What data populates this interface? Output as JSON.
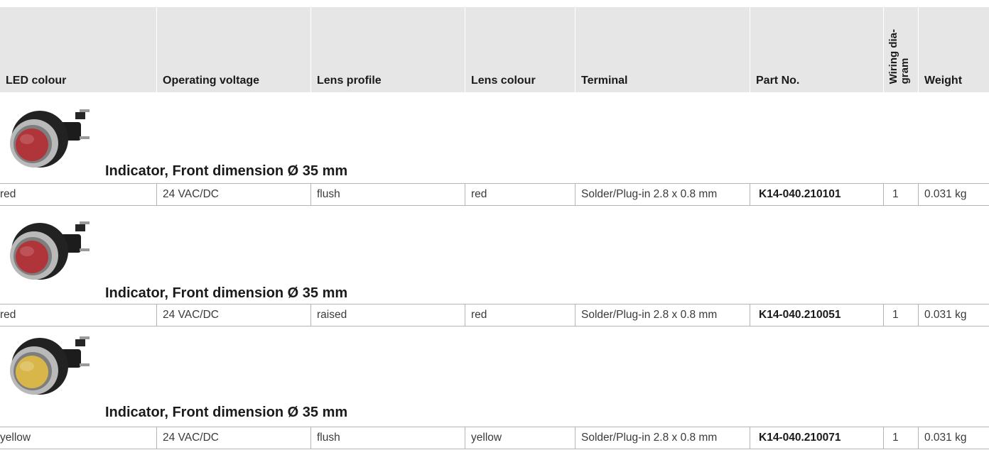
{
  "header": {
    "columns": [
      {
        "label": "LED colour"
      },
      {
        "label": "Operating voltage"
      },
      {
        "label": "Lens profile"
      },
      {
        "label": "Lens colour"
      },
      {
        "label": "Terminal"
      },
      {
        "label": "Part No."
      },
      {
        "label": "Wiring dia-\ngram"
      },
      {
        "label": "Weight"
      }
    ]
  },
  "groups": [
    {
      "title": "Indicator, Front dimension Ø 35 mm",
      "lens_color": "#b0353a",
      "row": {
        "led_colour": "red",
        "operating_voltage": "24 VAC/DC",
        "lens_profile": "flush",
        "lens_colour": "red",
        "terminal": "Solder/Plug-in 2.8 x 0.8 mm",
        "part_no": "K14-040.210101",
        "wiring_diagram": "1",
        "weight": "0.031 kg"
      }
    },
    {
      "title": "Indicator, Front dimension Ø 35 mm",
      "lens_color": "#b0353a",
      "row": {
        "led_colour": "red",
        "operating_voltage": "24 VAC/DC",
        "lens_profile": "raised",
        "lens_colour": "red",
        "terminal": "Solder/Plug-in 2.8 x 0.8 mm",
        "part_no": "K14-040.210051",
        "wiring_diagram": "1",
        "weight": "0.031 kg"
      }
    },
    {
      "title": "Indicator, Front dimension Ø 35 mm",
      "lens_color": "#d9b64a",
      "row": {
        "led_colour": "yellow",
        "operating_voltage": "24 VAC/DC",
        "lens_profile": "flush",
        "lens_colour": "yellow",
        "terminal": "Solder/Plug-in 2.8 x 0.8 mm",
        "part_no": "K14-040.210071",
        "wiring_diagram": "1",
        "weight": "0.031 kg"
      }
    }
  ]
}
